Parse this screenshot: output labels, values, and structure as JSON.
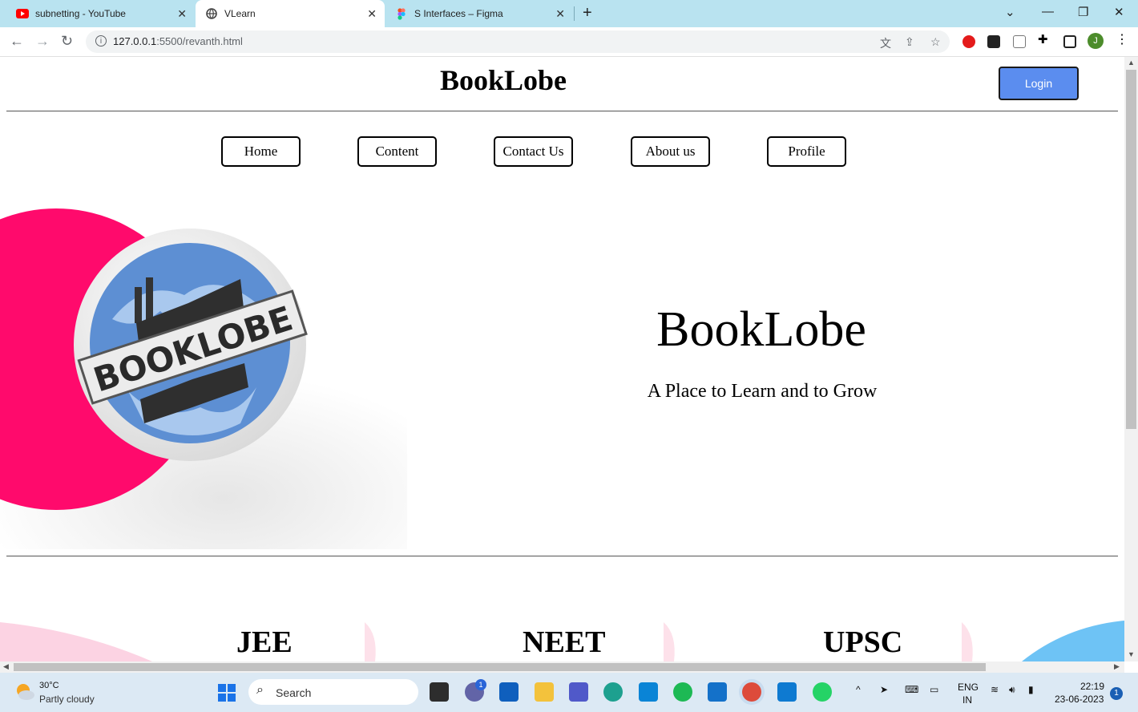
{
  "browser": {
    "tabs": [
      {
        "title": "subnetting - YouTube",
        "icon": "youtube-icon",
        "active": false
      },
      {
        "title": "VLearn",
        "icon": "globe-icon",
        "active": true
      },
      {
        "title": "S Interfaces – Figma",
        "icon": "figma-icon",
        "active": false
      }
    ],
    "url_host": "127.0.0.1",
    "url_rest": ":5500/revanth.html",
    "profile_initial": "J"
  },
  "page": {
    "site_title": "BookLobe",
    "login_label": "Login",
    "nav": [
      "Home",
      "Content",
      "Contact Us",
      "About us",
      "Profile"
    ],
    "hero": {
      "title": "BookLobe",
      "tagline": "A Place to Learn and to Grow",
      "badge_text": "BOOKLOBE"
    },
    "courses": [
      "JEE",
      "NEET",
      "UPSC"
    ],
    "colors": {
      "accent_pink": "#ff0a6c",
      "login_blue": "#5b8def"
    }
  },
  "taskbar": {
    "temperature": "30°C",
    "weather": "Partly cloudy",
    "search_label": "Search",
    "language_top": "ENG",
    "language_bottom": "IN",
    "time": "22:19",
    "date": "23-06-2023",
    "notification_count": "1",
    "teams_badge": "1"
  }
}
